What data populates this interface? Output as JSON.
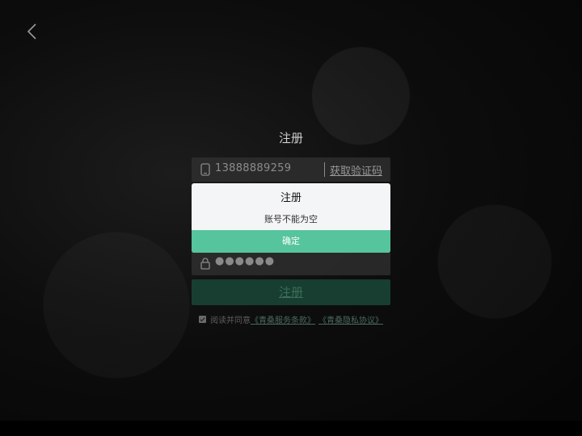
{
  "page": {
    "title": "注册"
  },
  "form": {
    "phone_value": "13888889259",
    "get_code_label": "获取验证码",
    "password_value": "●●●●●●",
    "register_label": "注册"
  },
  "agreement": {
    "prefix": "阅读并同意",
    "terms_link": "《青桑服务条款》",
    "privacy_link": "《青桑隐私协议》",
    "checked": true
  },
  "dialog": {
    "title": "注册",
    "message": "账号不能为空",
    "ok_label": "确定"
  },
  "icons": {
    "back": "chevron-left-icon",
    "phone": "phone-icon",
    "lock": "lock-icon"
  },
  "colors": {
    "accent": "#56c49c",
    "accent_dim": "#173e30",
    "dialog_bg": "#f4f5f7"
  }
}
